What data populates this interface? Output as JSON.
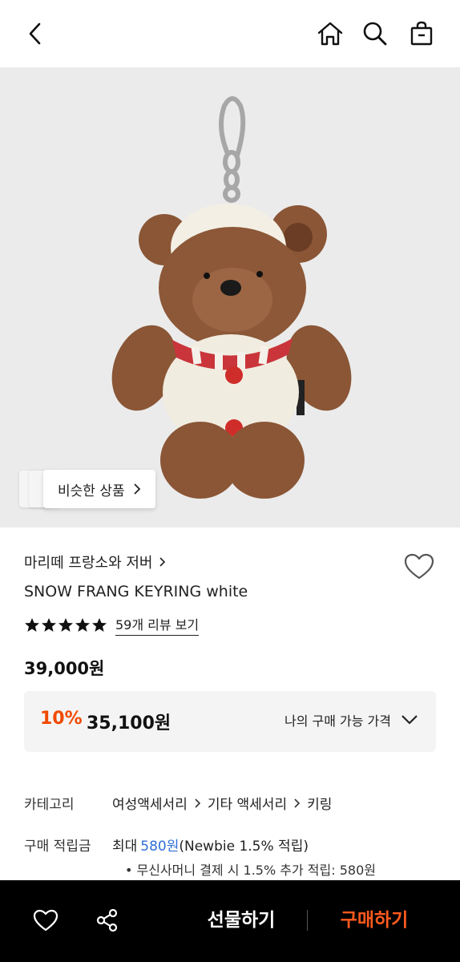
{
  "header": {
    "back_icon": "chevron-left-icon",
    "home_icon": "home-icon",
    "search_icon": "search-icon",
    "cart_icon": "shopping-bag-icon"
  },
  "hero": {
    "similar_label": "비슷한 상품",
    "bg_color": "#ebebeb"
  },
  "product": {
    "brand": "마리떼 프랑소와 저버",
    "title": "SNOW FRANG KEYRING white",
    "rating_stars": 5,
    "review_link": "59개 리뷰 보기",
    "price": "39,000원",
    "discount_rate": "10%",
    "discount_price": "35,100원",
    "my_price_label": "나의 구매 가능 가격"
  },
  "specs": {
    "category_label": "카테고리",
    "category_path": [
      "여성액세서리",
      "기타 액세서리",
      "키링"
    ],
    "points_label": "구매 적립금",
    "points_prefix": "최대",
    "points_amount": "580원",
    "points_suffix": "(Newbie 1.5% 적립)",
    "points_bullet": "• 무신사머니 결제 시 1.5% 추가 적립: 580원"
  },
  "bottom_bar": {
    "wish_icon": "heart-icon",
    "share_icon": "share-icon",
    "gift_label": "선물하기",
    "buy_label": "구매하기"
  },
  "colors": {
    "accent_orange": "#f04a00",
    "buy_orange": "#ff5a1f",
    "link_blue": "#2f6fd6"
  }
}
